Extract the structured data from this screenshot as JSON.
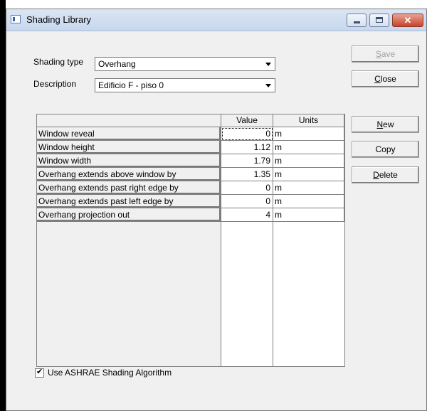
{
  "window": {
    "title": "Shading Library"
  },
  "form": {
    "shading_type_label": "Shading type",
    "shading_type_value": "Overhang",
    "description_label": "Description",
    "description_value": "Edificio F - piso 0"
  },
  "buttons": {
    "save": "Save",
    "close": "Close",
    "new": "New",
    "copy": "Copy",
    "delete": "Delete"
  },
  "table": {
    "columns": [
      "",
      "Value",
      "Units"
    ],
    "rows": [
      {
        "name": "Window reveal",
        "value": "0",
        "unit": "m"
      },
      {
        "name": "Window height",
        "value": "1.12",
        "unit": "m"
      },
      {
        "name": "Window width",
        "value": "1.79",
        "unit": "m"
      },
      {
        "name": "Overhang extends above window by",
        "value": "1.35",
        "unit": "m"
      },
      {
        "name": "Overhang extends past right edge by",
        "value": "0",
        "unit": "m"
      },
      {
        "name": "Overhang extends past left edge by",
        "value": "0",
        "unit": "m"
      },
      {
        "name": "Overhang projection out",
        "value": "4",
        "unit": "m"
      }
    ]
  },
  "options": {
    "ashrae_label": "Use ASHRAE Shading Algorithm",
    "ashrae_checked": true
  }
}
